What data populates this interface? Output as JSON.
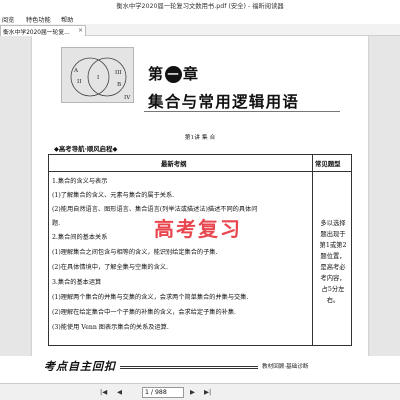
{
  "window": {
    "title": "衡水中学2020届一轮复习文数用书.pdf (安全) - 福昕阅读器"
  },
  "menu": {
    "items": [
      "阅览",
      "特色功能",
      "帮助"
    ]
  },
  "tab": {
    "label": "衡水中学2020届一轮复...",
    "close_icon": "close-icon"
  },
  "page": {
    "venn_labels": {
      "A": "A",
      "B": "B",
      "I": "I",
      "II": "II",
      "III": "III",
      "IV": "IV"
    },
    "chapter_prefix": "第",
    "chapter_number": "一",
    "chapter_suffix": "章",
    "chapter_name": "集合与常用逻辑用语",
    "lesson": "第1讲  集  合",
    "nav_title": "◆高考导航·顺风启程◆",
    "table": {
      "header_left": "最新考纲",
      "header_right": "常见题型",
      "lines": [
        {
          "text": "1.集合的含义与表示",
          "bold": false
        },
        {
          "text": "(1)了解集合的含义、元素与集合的属于关系.",
          "bold": false
        },
        {
          "text": "(2)能用自然语言、图形语言、集合语言(列举法或描述法)描述不同的具体问",
          "bold": false
        },
        {
          "text": "题.",
          "bold": false
        },
        {
          "text": "2.集合间的基本关系",
          "bold": false
        },
        {
          "text": "(1)理解集合之间包含与相等的含义，能识别给定集合的子集.",
          "bold": false
        },
        {
          "text": "(2)在具体情境中，了解全集与空集的含义.",
          "bold": false
        },
        {
          "text": "3.集合的基本运算",
          "bold": false
        },
        {
          "text": "(1)理解两个集合的并集与交集的含义，会求两个简单集合的并集与交集.",
          "bold": false
        },
        {
          "text": "(2)理解在给定集合中一个子集的补集的含义，会求给定子集的补集.",
          "bold": false
        },
        {
          "text": "(3)能使用 Venn 图表示集合的关系及运算.",
          "bold": false
        }
      ],
      "right_text": "多以选择题出现于第1或第2题位置，是高考必考内容，占5分左右。"
    },
    "watermark": "高考复习",
    "banner_title": "考点自主回扣",
    "banner_right": "教材回顾·基础诊断"
  },
  "status": {
    "page_input": "1 / 988",
    "first": "|◀",
    "prev": "◀",
    "next": "▶",
    "last": "▶|"
  }
}
